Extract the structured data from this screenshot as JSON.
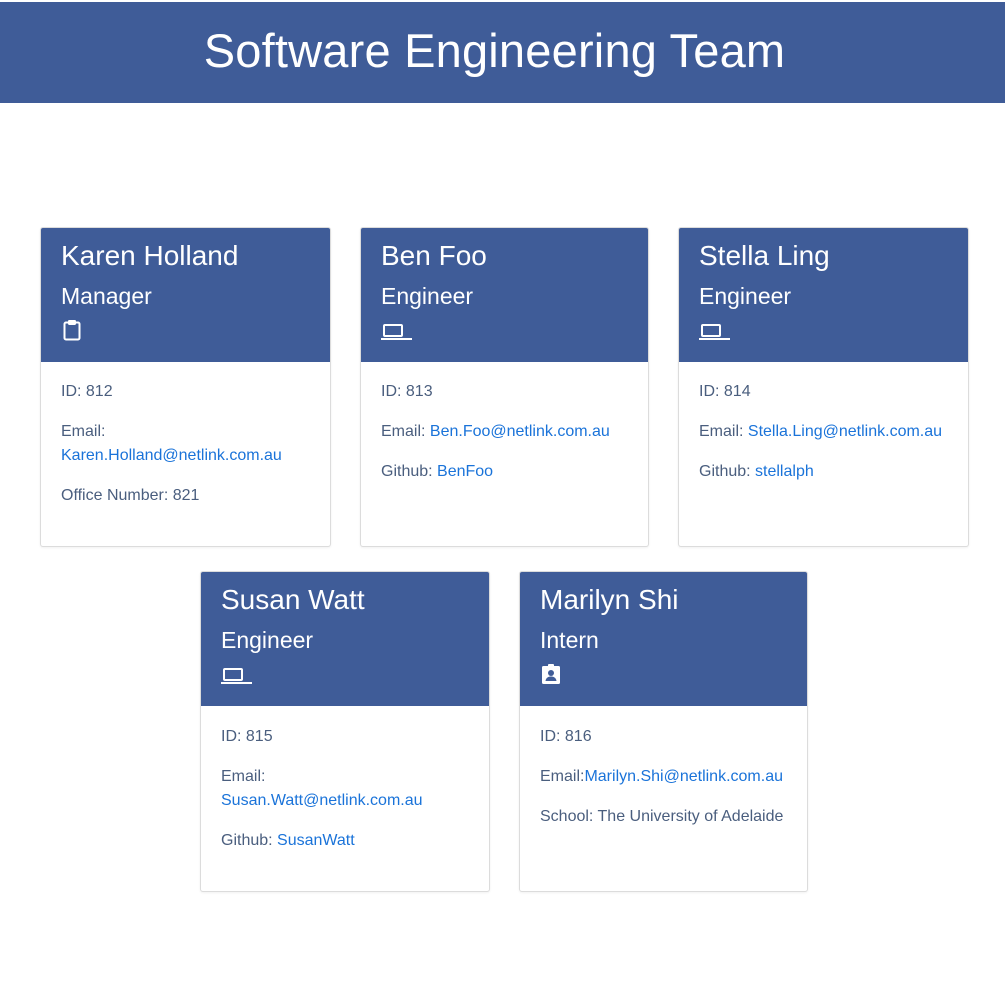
{
  "header": {
    "title": "Software Engineering Team"
  },
  "team": [
    {
      "name": "Karen Holland",
      "role": "Manager",
      "icon": "clipboard-icon",
      "id_line": "ID: 812",
      "email_label": "Email:",
      "email": "Karen.Holland@netlink.com.au",
      "extra_label": "Office Number: 821",
      "extra_value": ""
    },
    {
      "name": "Ben Foo",
      "role": "Engineer",
      "icon": "laptop-icon",
      "id_line": "ID: 813",
      "email_label": "Email: ",
      "email": "Ben.Foo@netlink.com.au",
      "extra_label": "Github: ",
      "extra_value": "BenFoo"
    },
    {
      "name": "Stella Ling",
      "role": "Engineer",
      "icon": "laptop-icon",
      "id_line": "ID: 814",
      "email_label": "Email: ",
      "email": "Stella.Ling@netlink.com.au",
      "extra_label": "Github: ",
      "extra_value": "stellalph"
    },
    {
      "name": "Susan Watt",
      "role": "Engineer",
      "icon": "laptop-icon",
      "id_line": "ID: 815",
      "email_label": "Email:",
      "email": "Susan.Watt@netlink.com.au",
      "extra_label": "Github: ",
      "extra_value": "SusanWatt"
    },
    {
      "name": "Marilyn Shi",
      "role": "Intern",
      "icon": "id-badge-icon",
      "id_line": "ID: 816",
      "email_label": "Email:",
      "email": "Marilyn.Shi@netlink.com.au",
      "extra_label": "School: The University of Adelaide",
      "extra_value": ""
    }
  ],
  "colors": {
    "header_bg": "#3f5c98",
    "link": "#1a73d9",
    "body_text": "#4a5e7e"
  }
}
